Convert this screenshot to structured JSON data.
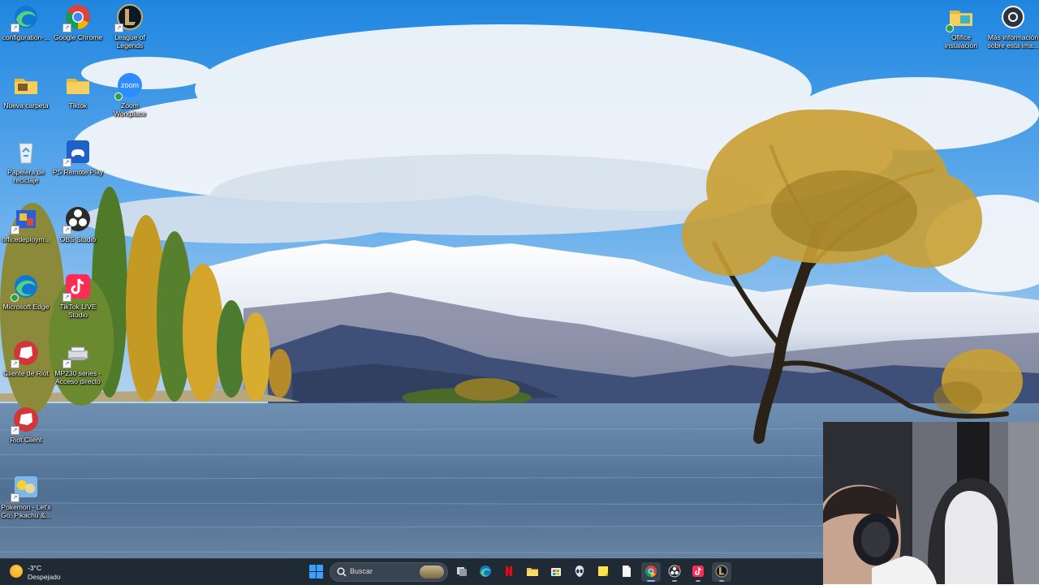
{
  "desktop": {
    "icons": [
      {
        "id": "configuration",
        "label": "configuration-...",
        "icon": "edge-icon"
      },
      {
        "id": "chrome",
        "label": "Google Chrome",
        "icon": "chrome-icon"
      },
      {
        "id": "lol",
        "label": "League of Legends",
        "icon": "league-of-legends-icon"
      },
      {
        "id": "nueva-carpeta",
        "label": "Nueva carpeta",
        "icon": "folder-icon"
      },
      {
        "id": "tiktok-folder",
        "label": "Tiktok",
        "icon": "folder-icon"
      },
      {
        "id": "zoom",
        "label": "Zoom Workplace",
        "icon": "zoom-icon",
        "glyph_text": "zoom"
      },
      {
        "id": "papelera",
        "label": "Papelera de reciclaje",
        "icon": "recycle-bin-icon"
      },
      {
        "id": "ps-remote",
        "label": "PS Remote Play",
        "icon": "ps-remote-play-icon"
      },
      {
        "id": "officedeploy",
        "label": "officedeploym...",
        "icon": "office-deployment-icon"
      },
      {
        "id": "obs",
        "label": "OBS Studio",
        "icon": "obs-icon"
      },
      {
        "id": "edge",
        "label": "Microsoft Edge",
        "icon": "edge-icon"
      },
      {
        "id": "tiktok-live",
        "label": "TikTok LIVE Studio",
        "icon": "tiktok-icon"
      },
      {
        "id": "riot-client-1",
        "label": "Cliente de Riot",
        "icon": "riot-icon"
      },
      {
        "id": "mp230",
        "label": "MP230 series - Acceso directo",
        "icon": "printer-icon"
      },
      {
        "id": "riot-client-2",
        "label": "Riot Client",
        "icon": "riot-icon"
      },
      {
        "id": "pokemon",
        "label": "Pokemon - Let's Go, Pikachu &...",
        "icon": "pokemon-icon"
      },
      {
        "id": "office-inst",
        "label": "Ofifice instalacion",
        "icon": "folder-icon"
      },
      {
        "id": "more-info",
        "label": "Más información sobre esta ima...",
        "icon": "camera-info-icon"
      }
    ]
  },
  "taskbar": {
    "weather": {
      "temp": "-3°C",
      "condition": "Despejado"
    },
    "search_placeholder": "Buscar",
    "apps": [
      "task-view-icon",
      "edge-icon",
      "netflix-icon",
      "file-explorer-icon",
      "store-icon",
      "alienware-icon",
      "sticky-notes-icon",
      "notepad-icon",
      "chrome-icon",
      "obs-icon",
      "tiktok-icon",
      "league-of-legends-icon"
    ]
  },
  "colors": {
    "taskbar_bg": "#1f2a35",
    "accent": "#3aa0ff",
    "sky": "#2f8fdc",
    "lake": "#5a7da0"
  }
}
